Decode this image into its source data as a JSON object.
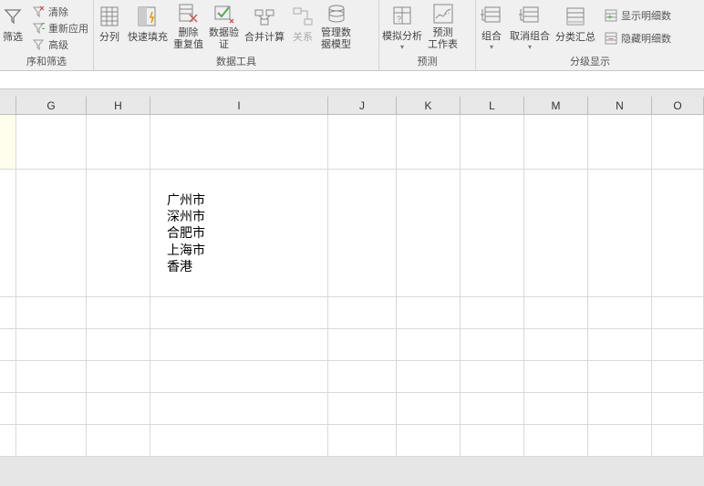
{
  "ribbon": {
    "group_sort": {
      "filter_btn": "筛选",
      "clear": "清除",
      "reapply": "重新应用",
      "advanced": "高级",
      "label": "序和筛选"
    },
    "group_data_tools": {
      "text_to_cols": "分列",
      "flash_fill": "快速填充",
      "remove_dup": "删除\n重复值",
      "data_valid": "数据验\n证",
      "consolidate": "合并计算",
      "relations": "关系",
      "manage_model": "管理数\n据模型",
      "label": "数据工具"
    },
    "group_forecast": {
      "whatif": "模拟分析",
      "forecast_sheet": "预测\n工作表",
      "label": "预测"
    },
    "group_outline": {
      "group": "组合",
      "ungroup": "取消组合",
      "subtotal": "分类汇总",
      "show_detail": "显示明细数",
      "hide_detail": "隐藏明细数",
      "label": "分级显示"
    }
  },
  "columns": [
    "G",
    "H",
    "I",
    "J",
    "K",
    "L",
    "M",
    "N",
    "O"
  ],
  "col_widths": {
    "lead": 18,
    "G": 77,
    "H": 70,
    "I": 195,
    "J": 75,
    "K": 70,
    "L": 70,
    "M": 70,
    "N": 70,
    "O": 57
  },
  "cell_content": {
    "city1": "广州市",
    "city2": "深州市",
    "city3": "合肥市",
    "city4": "上海市",
    "city5": "香港"
  }
}
